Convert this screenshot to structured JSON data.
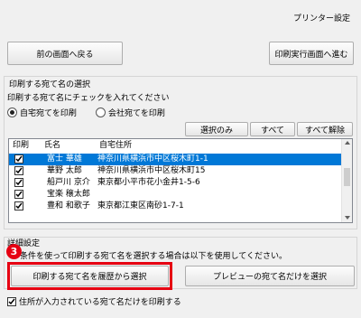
{
  "window_title": "プリンター設定",
  "top_buttons": {
    "back": "前の画面へ戻る",
    "next": "印刷実行画面へ進む"
  },
  "selection_group": {
    "title": "印刷する宛て名の選択",
    "instruction": "印刷する宛て名にチェックを入れてください",
    "radio_home": "自宅宛てを印刷",
    "radio_company": "会社宛てを印刷",
    "selected_radio": "home",
    "btn_select_only": "選択のみ",
    "btn_all": "すべて",
    "btn_clear_all": "すべて解除"
  },
  "list": {
    "columns": [
      "印刷",
      "氏名",
      "自宅住所"
    ],
    "rows": [
      {
        "name": "富士 華雄",
        "address": "神奈川県横浜市中区桜木町1-1",
        "checked": true,
        "selected": true
      },
      {
        "name": "華野 太郎",
        "address": "神奈川県横浜市中区桜木町15",
        "checked": true,
        "selected": false
      },
      {
        "name": "船戸川 京介",
        "address": "東京都小平市花小金井1-5-6",
        "checked": true,
        "selected": false
      },
      {
        "name": "宝楽 穣太郎",
        "address": "",
        "checked": true,
        "selected": false
      },
      {
        "name": "豊和 和歌子",
        "address": "東京都江東区南砂1-7-1",
        "checked": true,
        "selected": false
      }
    ]
  },
  "details": {
    "title": "詳細設定",
    "description": "条件を使って印刷する宛て名を選択する場合は以下を使用してください。",
    "step_number": "3",
    "btn_from_history": "印刷する宛て名を履歴から選択",
    "btn_preview_only": "プレビューの宛て名だけを選択",
    "checkbox_label": "住所が入力されている宛て名だけを印刷する",
    "checkbox_checked": true
  },
  "colors": {
    "highlight": "#0078d7",
    "step_badge": "#e60012",
    "callout_border": "#e60012"
  }
}
